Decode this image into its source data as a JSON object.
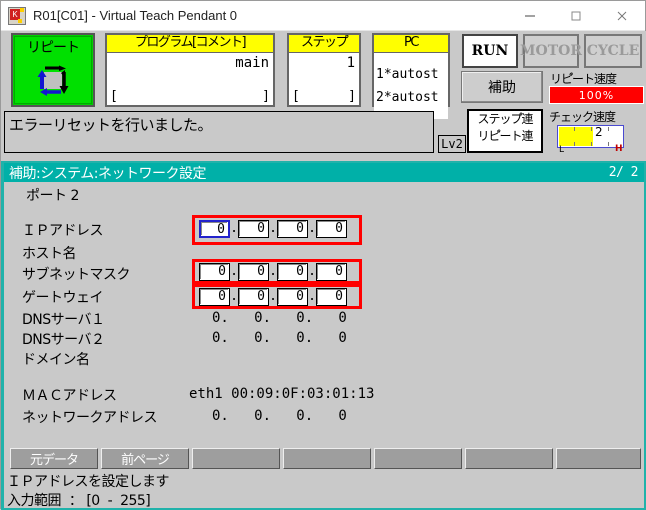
{
  "window": {
    "title": "R01[C01] - Virtual Teach Pendant 0",
    "minimize_label": "—",
    "maximize_label": "□",
    "close_label": "×"
  },
  "status_panels": {
    "mode": {
      "label": "リピート",
      "icon": "repeat-loop-icon"
    },
    "program": {
      "header": "プログラム[コメント]",
      "value": "main",
      "bracket_left": "[",
      "bracket_right": "]"
    },
    "step": {
      "header": "ステップ゚",
      "value": "1",
      "bracket_left": "[",
      "bracket_right": "]"
    },
    "pc": {
      "header": "PC",
      "line1": "1*autost",
      "line2": "2*autost"
    }
  },
  "lamps": {
    "run": "RUN",
    "motor": "MOTOR",
    "cycle": "CYCLE"
  },
  "buttons": {
    "hojo": "補助",
    "step_ren": "ステップ゚連",
    "repeat_ren": "リピ゚ート連"
  },
  "speed": {
    "repeat_label": "リピ゚ート速度",
    "repeat_value": "100%",
    "check_label": "チェック速度",
    "check_value": "2",
    "check_low": "L",
    "check_high": "H"
  },
  "message": {
    "text": "エラーリセットを行いました。",
    "level": "Lv2"
  },
  "screen": {
    "breadcrumb": "補助:システム:ネットワーク設定",
    "page": "2/  2",
    "port": "ポート 2"
  },
  "form": {
    "labels": {
      "ip_address": "ＩＰアドレス",
      "host_name": "ホスト名",
      "subnet_mask": "サブネットマスク",
      "gateway": "ゲートウェイ",
      "dns1": "DNSサーバ１",
      "dns2": "DNSサーバ２",
      "domain_name": "ドメイン名",
      "mac_address": "ＭＡＣアドレス",
      "network_address": "ネットワークアドレス"
    },
    "ip_address": [
      "0",
      "0",
      "0",
      "0"
    ],
    "host_name": "",
    "subnet_mask": [
      "0",
      "0",
      "0",
      "0"
    ],
    "gateway": [
      "0",
      "0",
      "0",
      "0"
    ],
    "dns1": "0.   0.   0.   0",
    "dns2": "0.   0.   0.   0",
    "domain_name": "",
    "mac_address": "eth1 00:09:0F:03:01:13",
    "network_address": "0.   0.   0.   0",
    "separator": "."
  },
  "softkeys": [
    {
      "label": "元データ"
    },
    {
      "label": "前ページ"
    },
    {
      "label": ""
    },
    {
      "label": ""
    },
    {
      "label": ""
    },
    {
      "label": ""
    },
    {
      "label": ""
    }
  ],
  "hints": {
    "line1": "ＩＰアドレスを設定します",
    "line2": "入力範囲  ： [0  -  255]"
  },
  "colors": {
    "accent_teal": "#00b0a8",
    "mode_green": "#00e000",
    "header_yellow": "#ffff00",
    "speed_red": "#ff0000",
    "focus_blue": "#2222cc",
    "highlight_red": "#ff0000"
  }
}
